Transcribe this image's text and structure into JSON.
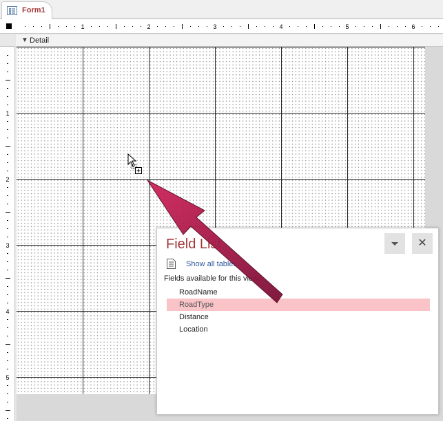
{
  "document_tab": {
    "title": "Form1"
  },
  "ruler": {
    "horizontal_numbers": [
      "1",
      "2",
      "3",
      "4",
      "5",
      "6"
    ],
    "vertical_numbers": [
      "1",
      "2",
      "3",
      "4",
      "5"
    ]
  },
  "section": {
    "label": "Detail"
  },
  "field_list": {
    "title": "Field List",
    "show_all_tables": "Show all tables",
    "available_heading": "Fields available for this view:",
    "fields": [
      {
        "name": "RoadName",
        "selected": false
      },
      {
        "name": "RoadType",
        "selected": true
      },
      {
        "name": "Distance",
        "selected": false
      },
      {
        "name": "Location",
        "selected": false
      }
    ],
    "dropdown_icon": "chevron-down-icon",
    "close_icon": "close-icon"
  },
  "annotation": {
    "type": "arrow",
    "color": "#a01646"
  },
  "colors": {
    "accent": "#a4373a",
    "link": "#2b579a",
    "selection": "#f9c3c7"
  }
}
